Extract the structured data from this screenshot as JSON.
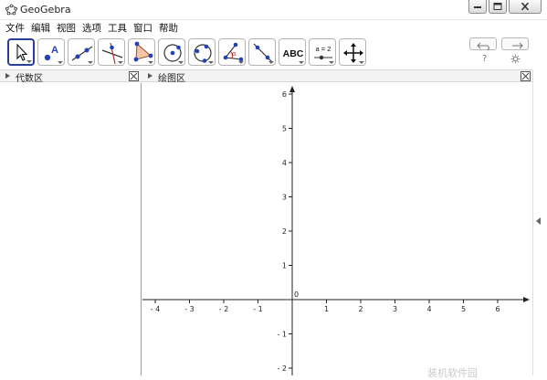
{
  "window": {
    "title": "GeoGebra"
  },
  "menu": {
    "items": [
      "文件",
      "编辑",
      "视图",
      "选项",
      "工具",
      "窗口",
      "帮助"
    ]
  },
  "toolbar": {
    "tools": [
      {
        "name": "move-tool",
        "selected": true
      },
      {
        "name": "new-point-tool"
      },
      {
        "name": "line-tool"
      },
      {
        "name": "perpendicular-line-tool"
      },
      {
        "name": "polygon-tool"
      },
      {
        "name": "circle-tool"
      },
      {
        "name": "conic-tool"
      },
      {
        "name": "angle-tool"
      },
      {
        "name": "reflect-tool"
      },
      {
        "name": "text-tool",
        "label": "ABC"
      },
      {
        "name": "slider-tool",
        "label": "a = 2"
      },
      {
        "name": "move-graphics-view-tool"
      }
    ],
    "undo_icon": "undo-icon",
    "redo_icon": "redo-icon",
    "help_label": "?",
    "settings_icon": "gear-icon"
  },
  "algebra_view": {
    "title": "代数区"
  },
  "graphics_view": {
    "title": "绘图区",
    "x_ticks": [
      -4,
      -3,
      -2,
      -1,
      0,
      1,
      2,
      3,
      4,
      5,
      6
    ],
    "y_ticks": [
      6,
      5,
      4,
      3,
      2,
      1,
      -1,
      -2
    ],
    "origin_label": "0"
  },
  "watermark": "装机软件园"
}
